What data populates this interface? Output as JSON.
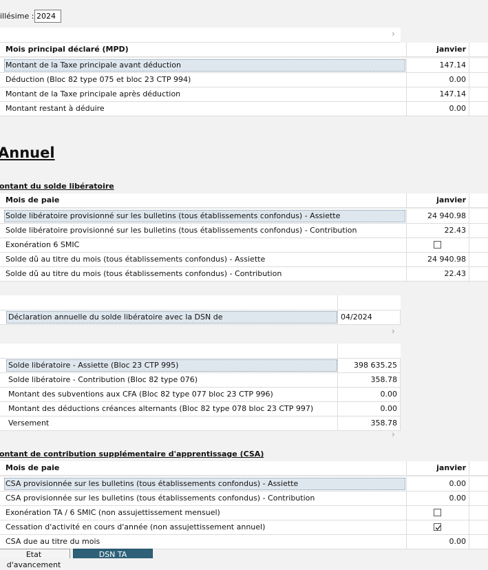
{
  "millesime": {
    "label": "illésime :",
    "value": "2024"
  },
  "tpa": {
    "header": {
      "label": "Mois principal déclaré (MPD)",
      "month": "janvier"
    },
    "rows": [
      {
        "label": "Montant de la Taxe principale avant déduction",
        "value": "147.14"
      },
      {
        "label": "Déduction (Bloc 82 type 075 et bloc 23 CTP 994)",
        "value": "0.00"
      },
      {
        "label": "Montant de la Taxe principale après déduction",
        "value": "147.14"
      },
      {
        "label": "Montant restant à déduire",
        "value": "0.00"
      }
    ]
  },
  "annuel_title": "Annuel",
  "solde": {
    "title": "ontant du solde libératoire",
    "header": {
      "label": "Mois de paie",
      "month": "janvier"
    },
    "rows": [
      {
        "label": "Solde libératoire provisionné sur les bulletins (tous établissements confondus) - Assiette",
        "value": "24 940.98"
      },
      {
        "label": "Solde libératoire provisionné sur les bulletins (tous établissements confondus) - Contribution",
        "value": "22.43"
      },
      {
        "label": "Exonération 6 SMIC",
        "checked": false
      },
      {
        "label": "Solde dû au titre du mois (tous établissements confondus) - Assiette",
        "value": "24 940.98"
      },
      {
        "label": "Solde dû au titre du mois (tous établissements confondus) - Contribution",
        "value": "22.43"
      }
    ]
  },
  "declaration": {
    "label": "Déclaration annuelle du solde libératoire avec la DSN de",
    "value": "04/2024"
  },
  "annual": {
    "rows": [
      {
        "label": "Solde libératoire - Assiette (Bloc 23 CTP 995)",
        "value": "398 635.25"
      },
      {
        "label": "Solde libératoire - Contribution (Bloc 82 type 076)",
        "value": "358.78"
      },
      {
        "label": "Montant des subventions aux CFA (Bloc 82 type 077 bloc 23 CTP 996)",
        "value": "0.00"
      },
      {
        "label": "Montant des déductions créances alternants (Bloc 82 type 078 bloc 23 CTP 997)",
        "value": "0.00"
      },
      {
        "label": "Versement",
        "value": "358.78"
      }
    ]
  },
  "csa": {
    "title": "ontant de contribution supplémentaire d'apprentissage (CSA)",
    "header": {
      "label": "Mois de paie",
      "month": "janvier"
    },
    "rows": [
      {
        "label": "CSA provisionnée sur les bulletins (tous établissements confondus) - Assiette",
        "value": "0.00"
      },
      {
        "label": "CSA provisionnée sur les bulletins (tous établissements confondus) - Contribution",
        "value": "0.00"
      },
      {
        "label": "Exonération TA / 6 SMIC (non assujettissement mensuel)",
        "checked": false
      },
      {
        "label": "Cessation d'activité en cours d'année (non assujettissement annuel)",
        "checked": true
      },
      {
        "label": "CSA due au titre du mois",
        "value": "0.00"
      }
    ]
  },
  "tabs": [
    {
      "label": "Etat d'avancement",
      "active": false
    },
    {
      "label": "DSN TA",
      "active": true
    }
  ]
}
